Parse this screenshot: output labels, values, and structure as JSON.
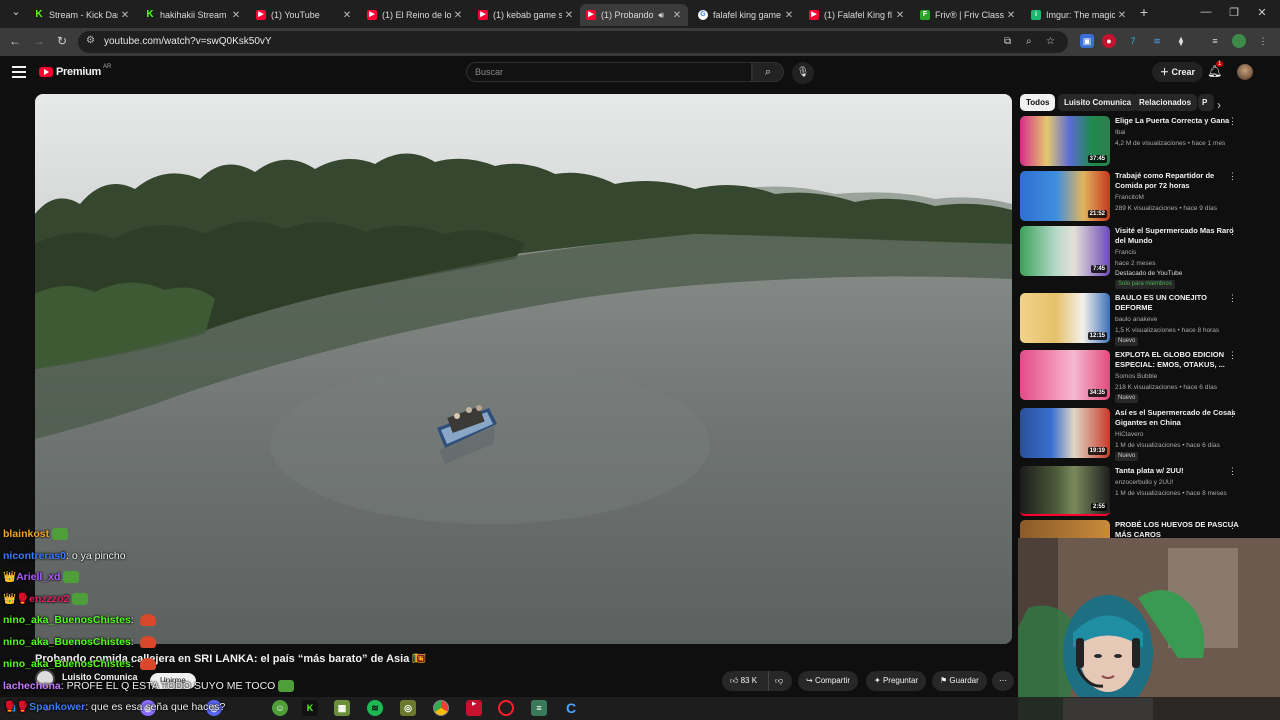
{
  "browser": {
    "tabs": [
      {
        "title": "Stream - Kick Das",
        "icon": "kick-icon"
      },
      {
        "title": "hakihakii Stream",
        "icon": "kick-icon"
      },
      {
        "title": "(1) YouTube",
        "icon": "youtube-icon"
      },
      {
        "title": "(1) El Reino de los",
        "icon": "youtube-icon"
      },
      {
        "title": "(1) kebab game s",
        "icon": "youtube-icon"
      },
      {
        "title": "(1) Probando",
        "icon": "youtube-icon"
      },
      {
        "title": "falafel king game",
        "icon": "google-icon"
      },
      {
        "title": "(1) Falafel King fl",
        "icon": "youtube-icon"
      },
      {
        "title": "Friv® | Friv Classi",
        "icon": "friv-icon"
      },
      {
        "title": "Imgur: The magic",
        "icon": "imgur-icon"
      }
    ],
    "new_tab": "+",
    "url": "youtube.com/watch?v=swQ0Ksk50vY"
  },
  "youtube": {
    "logo_text": "Premium",
    "country": "AR",
    "search_placeholder": "Buscar",
    "create_label": "Crear",
    "notifications": "1"
  },
  "video": {
    "title": "Probando comida callejera en SRI LANKA: el país “más barato” de Asia 🇱🇰",
    "channel": "Luisito Comunica",
    "join_label": "Unirme",
    "likes": "83 K",
    "share_label": "Compartir",
    "ask_label": "Preguntar",
    "save_label": "Guardar"
  },
  "sidebar": {
    "chips": [
      "Todos",
      "Luisito Comunica",
      "Relacionados",
      "P"
    ],
    "videos": [
      {
        "title": "Elige La Puerta Correcta y Gana",
        "channel": "Ibai",
        "meta": "4,2 M de visualizaciones • hace 1 mes",
        "duration": "37:45",
        "badge": "",
        "extra": ""
      },
      {
        "title": "Trabajé como Repartidor de Comida por 72 horas",
        "channel": "FrancitoM",
        "meta": "289 K visualizaciones • hace 9 días",
        "duration": "21:52",
        "badge": "",
        "extra": ""
      },
      {
        "title": "Visité el Supermercado Mas Raro del Mundo",
        "channel": "Francis",
        "meta": "hace 2 meses",
        "duration": "7:45",
        "badge": "Solo para miembros",
        "extra": "Destacado de YouTube"
      },
      {
        "title": "BAULO ES UN CONEJITO DEFORME",
        "channel": "baulo anakeve",
        "meta": "1,5 K visualizaciones • hace 8 horas",
        "duration": "12:15",
        "badge": "Nuevo",
        "extra": ""
      },
      {
        "title": "EXPLOTA EL GLOBO EDICION ESPECIAL: EMOS, OTAKUS, ...",
        "channel": "Somos Bubble",
        "meta": "218 K visualizaciones • hace 6 días",
        "duration": "34:35",
        "badge": "Nuevo",
        "extra": ""
      },
      {
        "title": "Así es el Supermercado de Cosas Gigantes en China",
        "channel": "HiClavero",
        "meta": "1 M de visualizaciones • hace 6 días",
        "duration": "19:19",
        "badge": "Nuevo",
        "extra": ""
      },
      {
        "title": "Tanta plata w/ 2UU!",
        "channel": "enzocerbullo y 2UU!",
        "meta": "1 M de visualizaciones • hace 8 meses",
        "duration": "2:55",
        "badge": "",
        "extra": ""
      },
      {
        "title": "PROBÉ LOS HUEVOS DE PASCUA MÁS CAROS",
        "channel": "",
        "meta": "",
        "duration": "",
        "badge": "",
        "extra": ""
      }
    ]
  },
  "chat": [
    {
      "user": "blainkost",
      "color": "#f5a623",
      "message": "",
      "prefix": ""
    },
    {
      "user": "nicontreras0",
      "color": "#3d7bff",
      "message": "o ya pincho",
      "prefix": ""
    },
    {
      "user": "Ariell_xd",
      "color": "#b05cff",
      "message": "",
      "prefix": "👑"
    },
    {
      "user": "enzzzo2",
      "color": "#e0245e",
      "message": "",
      "prefix": "👑🥊"
    },
    {
      "user": "nino_aka_BuenosChistes",
      "color": "#53fc18",
      "message": "",
      "prefix": ""
    },
    {
      "user": "nino_aka_BuenosChistes",
      "color": "#53fc18",
      "message": "",
      "prefix": ""
    },
    {
      "user": "nino_aka_BuenosChistes",
      "color": "#53fc18",
      "message": "",
      "prefix": ""
    },
    {
      "user": "lachechona",
      "color": "#c27cff",
      "message": "PROFE EL Q ESTA TODO SUYO ME TOCO",
      "prefix": ""
    },
    {
      "user": "Spankower",
      "color": "#3d7bff",
      "message": "que es esa seña que haces?",
      "prefix": "🥊🥊"
    }
  ],
  "taskbar_icons": [
    "start-icon",
    "search-icon",
    "chat-icon",
    "gamepad-icon",
    "frog-icon",
    "kick-icon",
    "minecraft-icon",
    "spotify-icon",
    "owl-icon",
    "chrome-icon",
    "twitter-icon",
    "opera-icon",
    "book-icon",
    "ccleaner-icon"
  ]
}
